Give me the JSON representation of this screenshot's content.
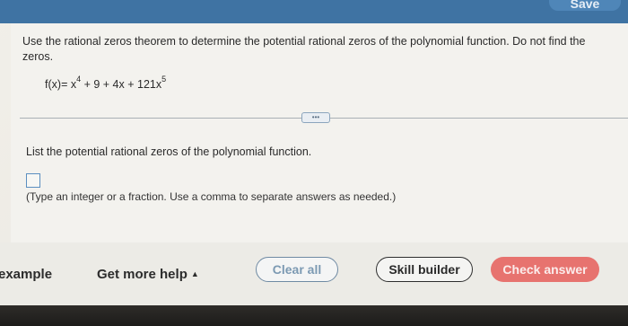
{
  "header": {
    "save_label": "Save"
  },
  "question": {
    "instructions": "Use the rational zeros theorem to determine the potential rational zeros of the polynomial function. Do not find the zeros.",
    "function_name": "f(x)",
    "equation_parts": [
      "= x",
      "4",
      " + 9 + 4x + 121x",
      "5"
    ],
    "more_label": "•••"
  },
  "answer": {
    "prompt": "List the potential rational zeros of the polynomial function.",
    "value": "",
    "hint": "(Type an integer or a fraction. Use a comma to separate answers as needed.)"
  },
  "footer": {
    "example_label": "example",
    "help_label": "Get more help",
    "help_caret": "▲",
    "clear_label": "Clear all",
    "skill_label": "Skill builder",
    "check_label": "Check answer"
  }
}
